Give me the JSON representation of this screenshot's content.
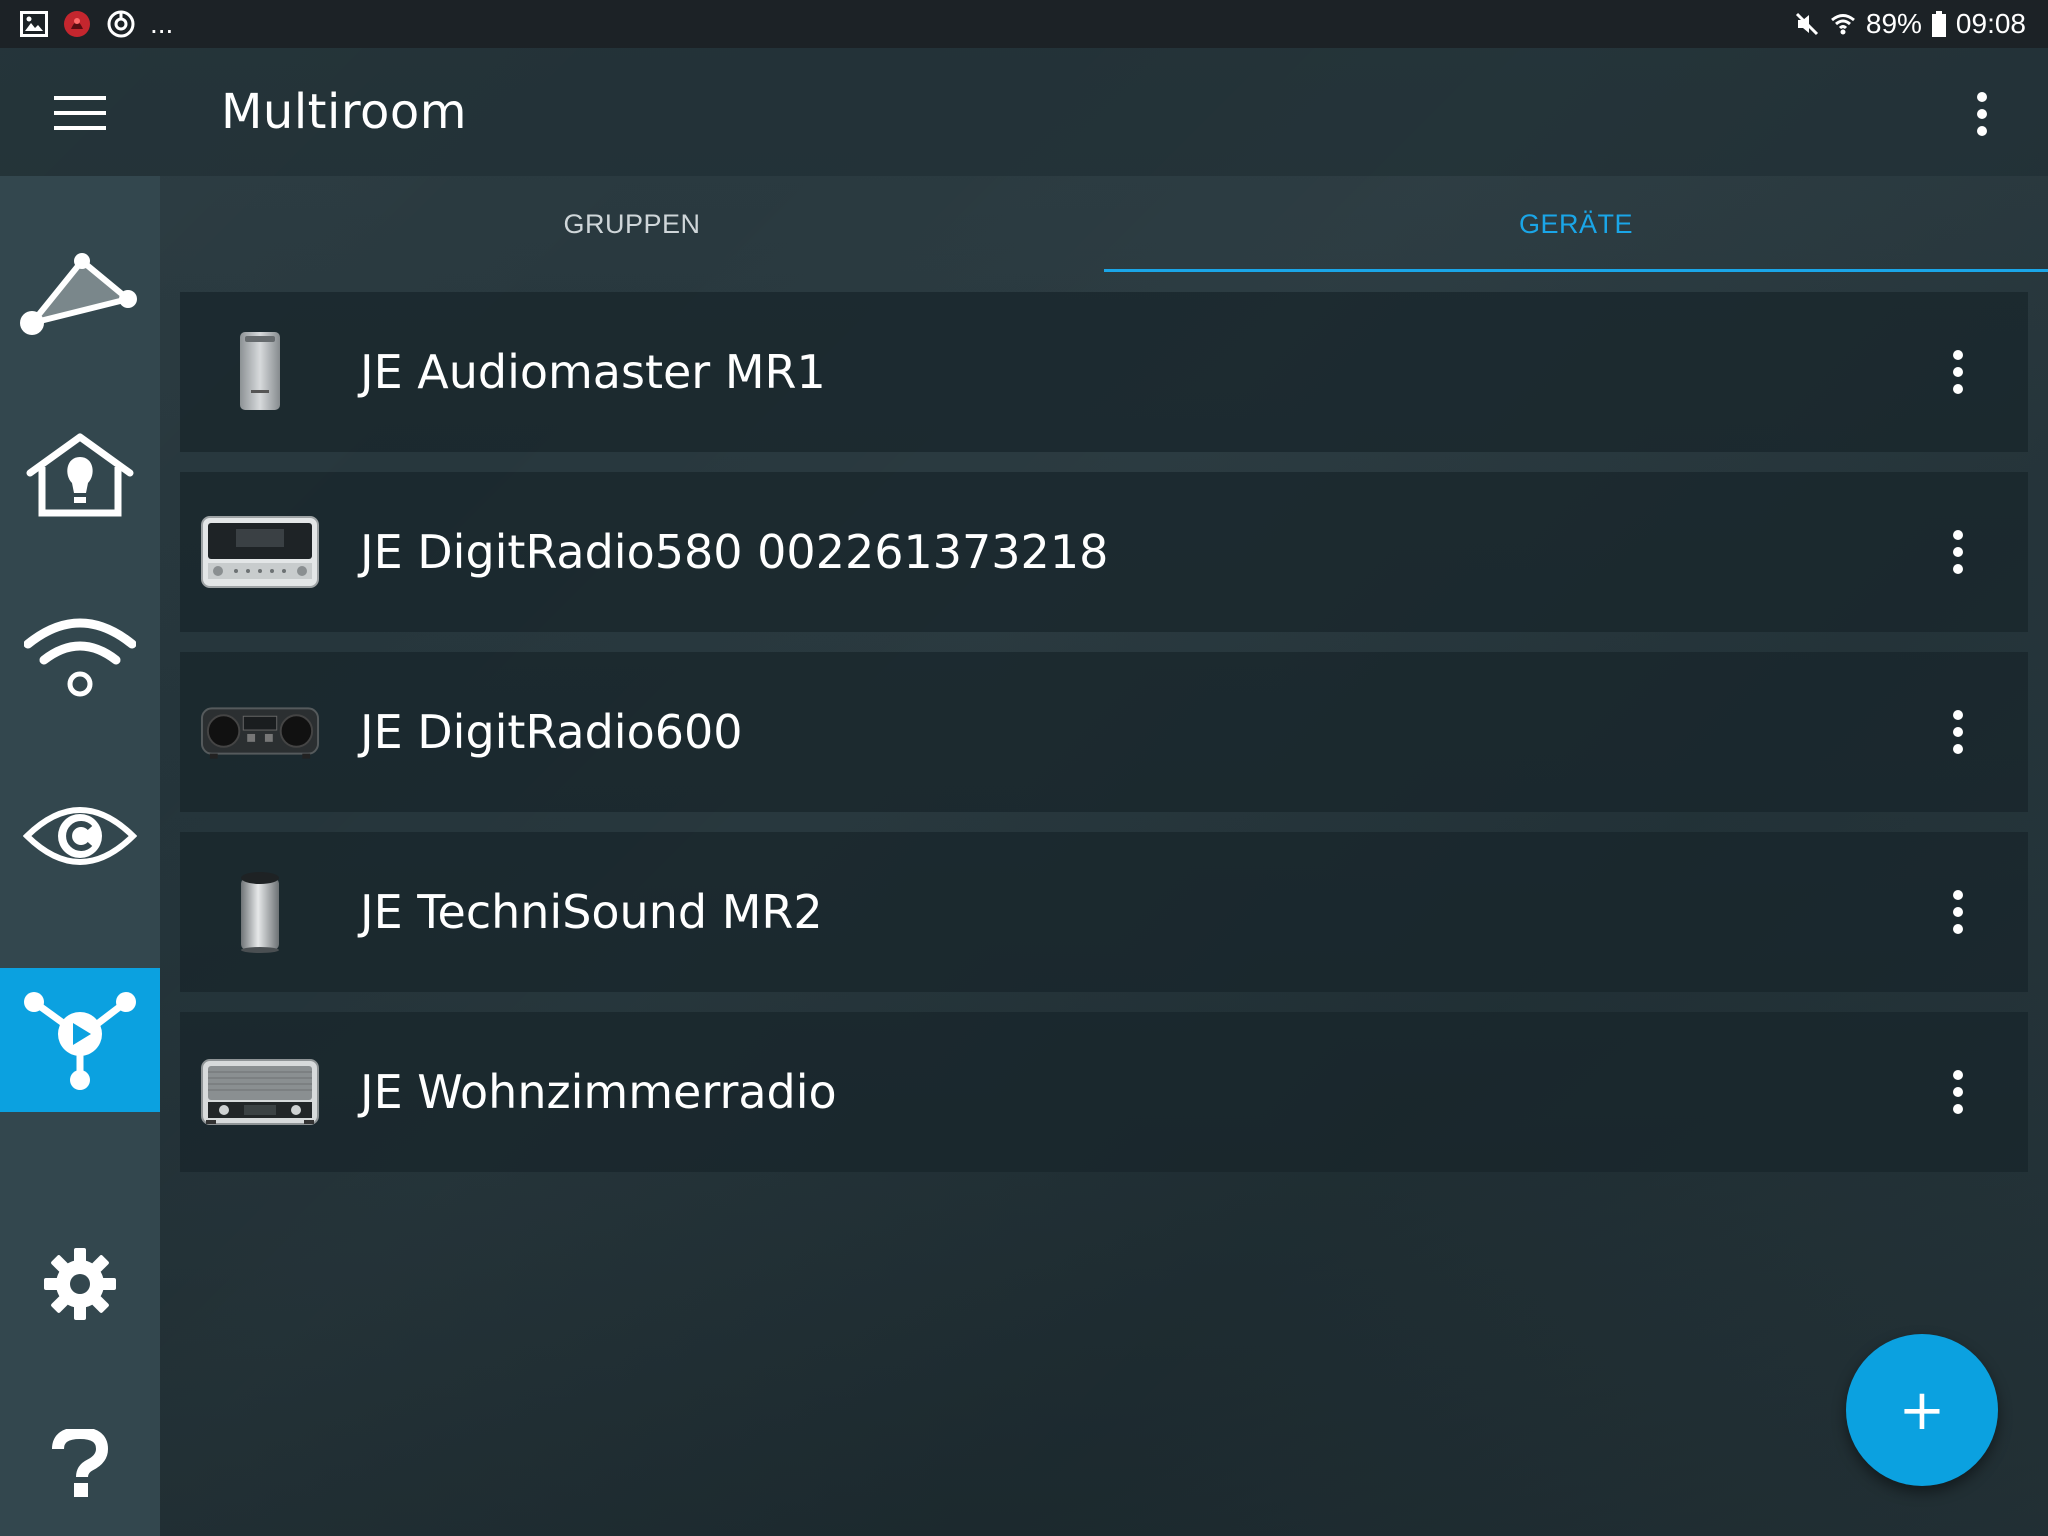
{
  "status_bar": {
    "left_icons": [
      "gallery-icon",
      "app-notification-icon",
      "sync-icon"
    ],
    "more": "...",
    "battery": "89%",
    "time": "09:08"
  },
  "app_bar": {
    "title": "Multiroom"
  },
  "tabs": [
    {
      "label": "GRUPPEN",
      "active": false
    },
    {
      "label": "GERÄTE",
      "active": true
    }
  ],
  "devices": [
    {
      "name": "JE Audiomaster MR1",
      "icon": "tower-speaker-icon"
    },
    {
      "name": "JE DigitRadio580 002261373218",
      "icon": "silver-radio-icon"
    },
    {
      "name": "JE DigitRadio600",
      "icon": "black-radio-icon"
    },
    {
      "name": "JE TechniSound MR2",
      "icon": "cylinder-speaker-icon"
    },
    {
      "name": "JE Wohnzimmerradio",
      "icon": "retro-radio-icon"
    }
  ],
  "fab_label": "+",
  "colors": {
    "accent": "#0ba1e0",
    "tab_active": "#1aa6e8",
    "sidebar": "#33474e",
    "background": "#24343a"
  }
}
